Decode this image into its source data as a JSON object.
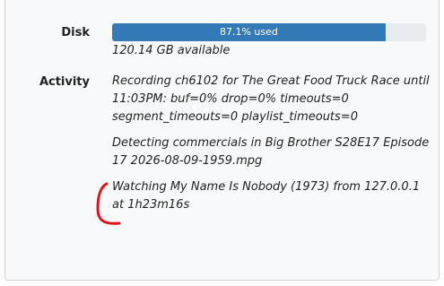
{
  "disk": {
    "label": "Disk",
    "used_text": "87.1% used",
    "used_fraction": 0.871,
    "bar_color": "#337ab7",
    "available_text": "120.14 GB available"
  },
  "activity": {
    "label": "Activity",
    "items": [
      "Recording ch6102 for The Great Food Truck Race until 11:03PM: buf=0% drop=0% timeouts=0 segment_timeouts=0 playlist_timeouts=0",
      "Detecting commercials in Big Brother S28E17 Episode 17 2026-08-09-1959.mpg",
      "Watching My Name Is Nobody (1973) from 127.0.0.1 at 1h23m16s"
    ]
  },
  "annotation": {
    "color": "#e0141e"
  }
}
